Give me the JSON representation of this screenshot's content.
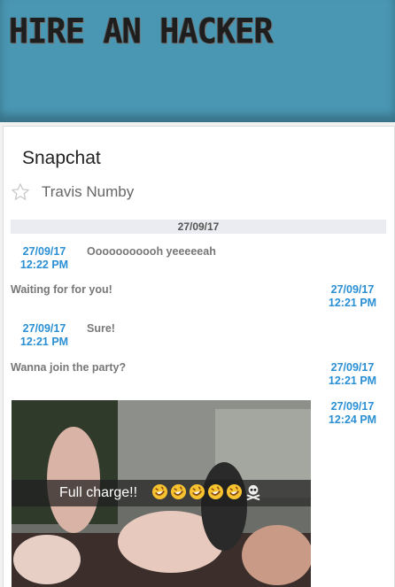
{
  "header": {
    "logo": "HIRE AN HACKER",
    "bg": "#4a97b3"
  },
  "chat": {
    "app_title": "Snapchat",
    "contact_name": "Travis Numby",
    "date_separator": "27/09/17",
    "messages": [
      {
        "text": "Ooooooooooh yeeeeeah",
        "date": "27/09/17",
        "time": "12:22 PM",
        "side": "left"
      },
      {
        "text": "Waiting for for you!",
        "date": "27/09/17",
        "time": "12:21 PM",
        "side": "right"
      },
      {
        "text": "Sure!",
        "date": "27/09/17",
        "time": "12:21 PM",
        "side": "left"
      },
      {
        "text": "Wanna join the party?",
        "date": "27/09/17",
        "time": "12:21 PM",
        "side": "right"
      },
      {
        "date": "27/09/17",
        "time": "12:24 PM",
        "side": "right",
        "image_caption": "Full charge!!"
      }
    ]
  },
  "icons": {
    "star": "star-outline-icon",
    "emoji": "rolling-laughing-emoji-icon",
    "skull": "skull-crossbones-icon"
  },
  "colors": {
    "timestamp": "#2a8fd3",
    "message": "#777777",
    "date_bar": "#ebecf1"
  }
}
